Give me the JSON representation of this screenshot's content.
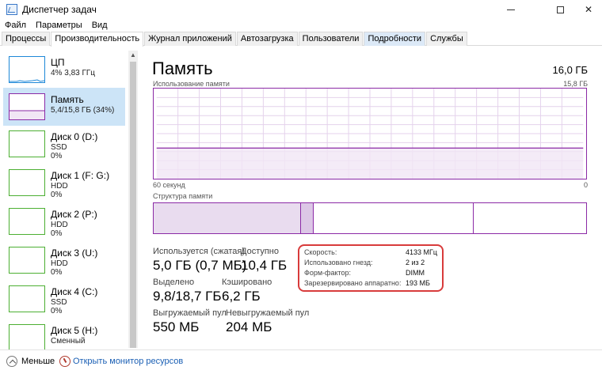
{
  "window": {
    "title": "Диспетчер задач",
    "icon": "task-manager-icon"
  },
  "menu": [
    "Файл",
    "Параметры",
    "Вид"
  ],
  "tabs": [
    {
      "label": "Процессы",
      "active": false
    },
    {
      "label": "Производительность",
      "active": true
    },
    {
      "label": "Журнал приложений",
      "active": false
    },
    {
      "label": "Автозагрузка",
      "active": false
    },
    {
      "label": "Пользователи",
      "active": false
    },
    {
      "label": "Подробности",
      "active": false
    },
    {
      "label": "Службы",
      "active": false
    }
  ],
  "sidebar": {
    "items": [
      {
        "title": "ЦП",
        "line1": "4% 3,83 ГГц",
        "line2": "",
        "color": "#1e88d8"
      },
      {
        "title": "Память",
        "line1": "5,4/15,8 ГБ (34%)",
        "line2": "",
        "color": "#8b2aa6",
        "selected": true
      },
      {
        "title": "Диск 0 (D:)",
        "line1": "SSD",
        "line2": "0%",
        "color": "#4caf32"
      },
      {
        "title": "Диск 1 (F: G:)",
        "line1": "HDD",
        "line2": "0%",
        "color": "#4caf32"
      },
      {
        "title": "Диск 2 (P:)",
        "line1": "HDD",
        "line2": "0%",
        "color": "#4caf32"
      },
      {
        "title": "Диск 3 (U:)",
        "line1": "HDD",
        "line2": "0%",
        "color": "#4caf32"
      },
      {
        "title": "Диск 4 (C:)",
        "line1": "SSD",
        "line2": "0%",
        "color": "#4caf32"
      },
      {
        "title": "Диск 5 (H:)",
        "line1": "Сменный",
        "line2": "",
        "color": "#4caf32"
      }
    ]
  },
  "memory": {
    "title": "Память",
    "total": "16,0 ГБ",
    "graph_label": "Использование памяти",
    "graph_max": "15,8 ГБ",
    "axis_left": "60 секунд",
    "axis_right": "0",
    "usage_fraction": 0.34,
    "structure_label": "Структура памяти",
    "structure": {
      "in_use": 0.34,
      "modified": 0.03,
      "standby": 0.37,
      "free": 0.26
    },
    "colors": {
      "line": "#8b2aa6",
      "fill": "#f1e6f5",
      "grid": "#e4d2ec"
    },
    "stats": {
      "in_use_label": "Используется (сжатая)",
      "in_use_value": "5,0 ГБ (0,7 МБ)",
      "available_label": "Доступно",
      "available_value": "10,4 ГБ",
      "committed_label": "Выделено",
      "committed_value": "9,8/18,7 ГБ",
      "cached_label": "Кэшировано",
      "cached_value": "6,2 ГБ",
      "paged_label": "Выгружаемый пул",
      "paged_value": "550 МБ",
      "nonpaged_label": "Невыгружаемый пул",
      "nonpaged_value": "204 МБ"
    },
    "info": [
      {
        "label": "Скорость:",
        "value": "4133 МГц"
      },
      {
        "label": "Использовано гнезд:",
        "value": "2 из 2"
      },
      {
        "label": "Форм-фактор:",
        "value": "DIMM"
      },
      {
        "label": "Зарезервировано аппаратно:",
        "value": "193 МБ"
      }
    ]
  },
  "footer": {
    "less_label": "Меньше",
    "monitor_link": "Открыть монитор ресурсов"
  }
}
